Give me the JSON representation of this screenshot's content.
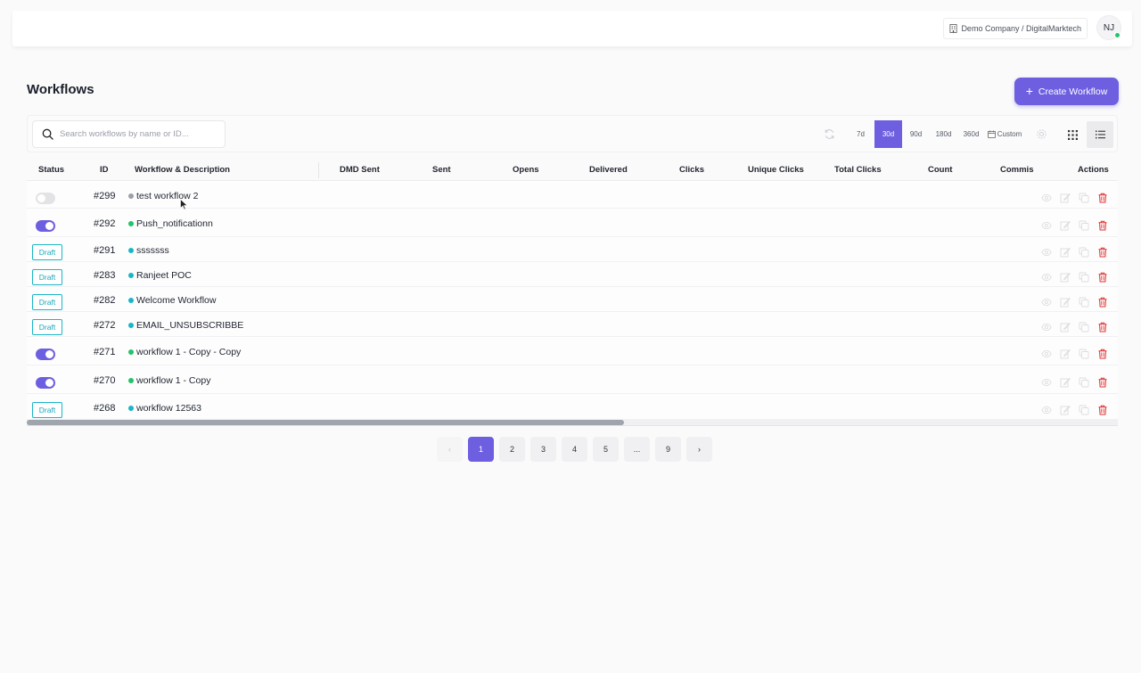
{
  "header": {
    "company": "Demo Company / DigitalMarktech",
    "avatar_initials": "NJ",
    "online_status_color": "#22c36b"
  },
  "page": {
    "title": "Workflows",
    "create_label": "Create Workflow",
    "accent_color": "#6d5fe0"
  },
  "toolbar": {
    "search_placeholder": "Search workflows by name or ID...",
    "ranges": [
      "7d",
      "30d",
      "90d",
      "180d",
      "360d"
    ],
    "active_range": "30d",
    "custom_label": "Custom",
    "active_view": "list"
  },
  "table": {
    "columns": {
      "status": "Status",
      "id": "ID",
      "workflow": "Workflow & Description",
      "dmd_sent": "DMD Sent",
      "sent": "Sent",
      "opens": "Opens",
      "delivered": "Delivered",
      "clicks": "Clicks",
      "unique_clicks": "Unique Clicks",
      "total_clicks": "Total Clicks",
      "count": "Count",
      "commission": "Commiss",
      "actions": "Actions"
    },
    "rows": [
      {
        "status": "toggle-off",
        "id": "#299",
        "name": "test workflow 2",
        "dot": "#9aa0a8"
      },
      {
        "status": "toggle-on",
        "id": "#292",
        "name": "Push_notificationn",
        "dot": "#22c36b"
      },
      {
        "status": "draft",
        "status_label": "Draft",
        "id": "#291",
        "name": "sssssss",
        "dot": "#19b6c7"
      },
      {
        "status": "draft",
        "status_label": "Draft",
        "id": "#283",
        "name": "Ranjeet POC",
        "dot": "#19b6c7"
      },
      {
        "status": "draft",
        "status_label": "Draft",
        "id": "#282",
        "name": "Welcome Workflow",
        "dot": "#19b6c7"
      },
      {
        "status": "draft",
        "status_label": "Draft",
        "id": "#272",
        "name": "EMAIL_UNSUBSCRIBBE",
        "dot": "#19b6c7"
      },
      {
        "status": "toggle-on",
        "id": "#271",
        "name": "workflow 1 - Copy - Copy",
        "dot": "#22c36b"
      },
      {
        "status": "toggle-on",
        "id": "#270",
        "name": "workflow 1 - Copy",
        "dot": "#22c36b"
      },
      {
        "status": "draft",
        "status_label": "Draft",
        "id": "#268",
        "name": "workflow 12563",
        "dot": "#19b6c7"
      }
    ],
    "actions_icons": [
      "eye-icon",
      "edit-icon",
      "copy-icon",
      "trash-icon"
    ]
  },
  "pagination": {
    "prev": "‹",
    "pages": [
      "1",
      "2",
      "3",
      "4",
      "5",
      "...",
      "9"
    ],
    "active_page": "1",
    "next": "›"
  }
}
